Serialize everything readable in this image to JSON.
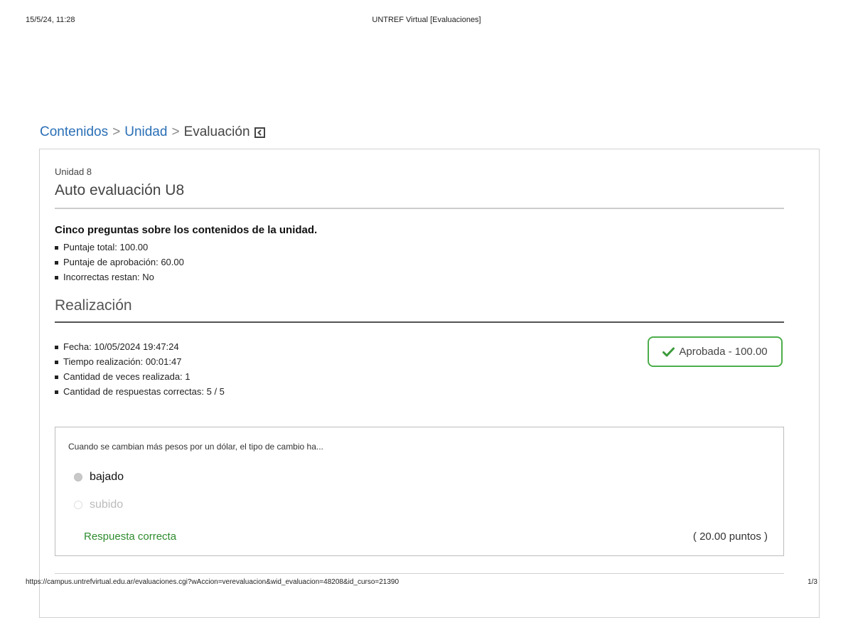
{
  "print_header": {
    "datetime": "15/5/24, 11:28",
    "page_title": "UNTREF Virtual [Evaluaciones]"
  },
  "print_footer": {
    "url": "https://campus.untrefvirtual.edu.ar/evaluaciones.cgi?wAccion=verevaluacion&wid_evaluacion=48208&id_curso=21390",
    "page_number": "1/3"
  },
  "breadcrumb": {
    "items": [
      "Contenidos",
      "Unidad"
    ],
    "separator": ">",
    "current": "Evaluación"
  },
  "evaluation": {
    "unit": "Unidad 8",
    "title": "Auto evaluación U8",
    "description": "Cinco preguntas sobre los contenidos de la unidad.",
    "details": [
      "Puntaje total: 100.00",
      "Puntaje de aprobación: 60.00",
      "Incorrectas restan: No"
    ]
  },
  "attempt": {
    "section_title": "Realización",
    "details": [
      "Fecha: 10/05/2024 19:47:24",
      "Tiempo realización: 00:01:47",
      "Cantidad de veces realizada: 1",
      "Cantidad de respuestas correctas: 5 / 5"
    ],
    "status": "Aprobada - 100.00",
    "status_color": "#4cae4c"
  },
  "question": {
    "text": "Cuando se cambian más pesos por un dólar, el tipo de cambio ha...",
    "options": [
      {
        "label": "bajado",
        "selected": true
      },
      {
        "label": "subido",
        "selected": false
      }
    ],
    "feedback": "Respuesta correcta",
    "feedback_color": "#2e8b2e",
    "points": "( 20.00 puntos )"
  },
  "colors": {
    "link": "#2a6fb6",
    "success": "#4cae4c"
  }
}
